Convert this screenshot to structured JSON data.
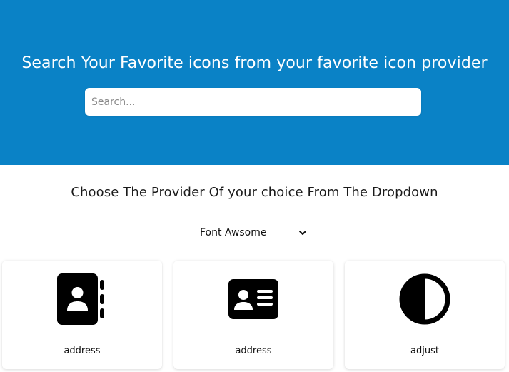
{
  "header": {
    "title": "Search Your Favorite icons from your favorite icon provider",
    "search_placeholder": "Search...",
    "search_value": ""
  },
  "provider": {
    "prompt": "Choose The Provider Of your choice From The Dropdown",
    "selected": "Font Awsome"
  },
  "icons": [
    {
      "label": "address",
      "icon": "address-book-icon"
    },
    {
      "label": "address",
      "icon": "address-card-icon"
    },
    {
      "label": "adjust",
      "icon": "adjust-icon"
    }
  ],
  "colors": {
    "header_bg": "#0A82C6",
    "icon_color": "#000000"
  }
}
